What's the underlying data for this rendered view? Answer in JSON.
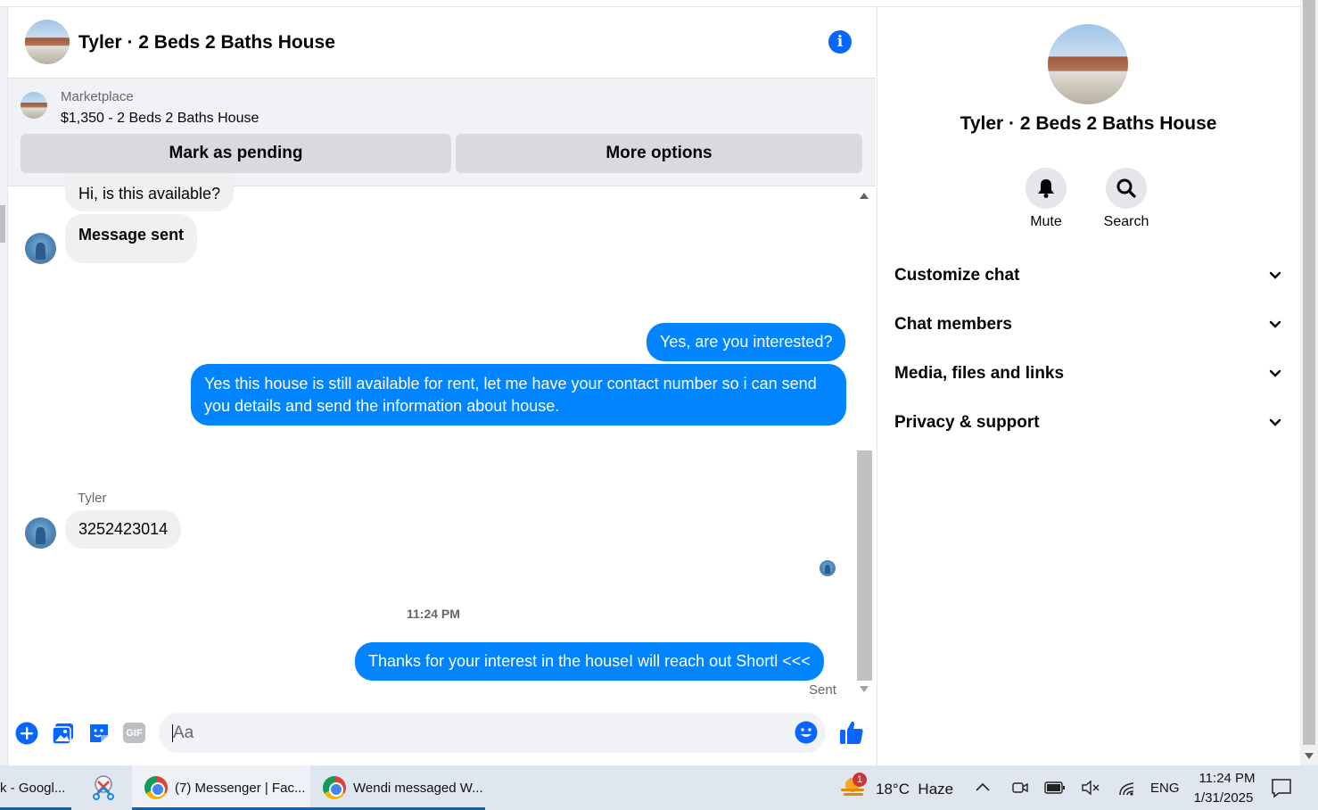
{
  "chat": {
    "title": "Tyler · 2 Beds 2 Baths House",
    "marketplace": {
      "label": "Marketplace",
      "listing": "$1,350 - 2 Beds 2 Baths House",
      "mark_pending_label": "Mark as pending",
      "more_options_label": "More options"
    },
    "messages": {
      "m1": "Hi, is this available?",
      "m2": "Message sent",
      "m3": "Yes, are you interested?",
      "m4": "Yes this house is still available for rent, let me have your contact number so i can send you details and send the information about house.",
      "sender_name": "Tyler",
      "m5": "3252423014",
      "timestamp": "11:24 PM",
      "m6": "Thanks for your interest in the houseI will reach out Shortl <<<",
      "status": "Sent"
    },
    "composer": {
      "placeholder": "Aa",
      "gif_label": "GIF"
    }
  },
  "right_panel": {
    "title": "Tyler · 2 Beds 2 Baths House",
    "mute_label": "Mute",
    "search_label": "Search",
    "sections": [
      "Customize chat",
      "Chat members",
      "Media, files and links",
      "Privacy & support"
    ]
  },
  "taskbar": {
    "item1": "k - Googl...",
    "item2": "(7) Messenger | Fac...",
    "item3": "Wendi messaged W...",
    "weather": "18°C  Haze",
    "weather_badge": "1",
    "language": "ENG",
    "time": "11:24 PM",
    "date": "1/31/2025"
  },
  "colors": {
    "accent": "#0866ff",
    "outgoing_bubble": "#0084ff",
    "incoming_bubble": "#f0f0f0"
  }
}
